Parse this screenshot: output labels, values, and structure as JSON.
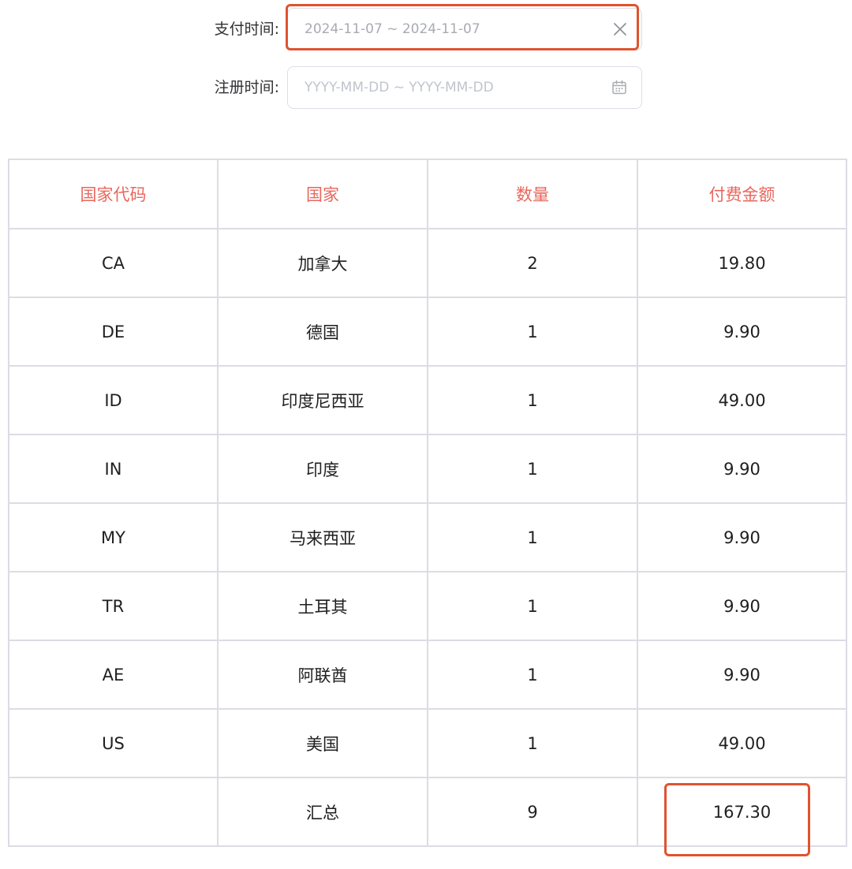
{
  "filters": {
    "pay_time": {
      "label": "支付时间:",
      "value": "2024-11-07 ~ 2024-11-07",
      "clear_icon": "close-icon"
    },
    "register_time": {
      "label": "注册时间:",
      "placeholder": "YYYY-MM-DD ~ YYYY-MM-DD",
      "icon": "calendar-icon"
    }
  },
  "table": {
    "headers": [
      "国家代码",
      "国家",
      "数量",
      "付费金额"
    ],
    "rows": [
      {
        "code": "CA",
        "country": "加拿大",
        "count": "2",
        "amount": "19.80"
      },
      {
        "code": "DE",
        "country": "德国",
        "count": "1",
        "amount": "9.90"
      },
      {
        "code": "ID",
        "country": "印度尼西亚",
        "count": "1",
        "amount": "49.00"
      },
      {
        "code": "IN",
        "country": "印度",
        "count": "1",
        "amount": "9.90"
      },
      {
        "code": "MY",
        "country": "马来西亚",
        "count": "1",
        "amount": "9.90"
      },
      {
        "code": "TR",
        "country": "土耳其",
        "count": "1",
        "amount": "9.90"
      },
      {
        "code": "AE",
        "country": "阿联酋",
        "count": "1",
        "amount": "9.90"
      },
      {
        "code": "US",
        "country": "美国",
        "count": "1",
        "amount": "49.00"
      }
    ],
    "summary": {
      "code": "",
      "country": "汇总",
      "count": "9",
      "amount": "167.30"
    }
  },
  "colors": {
    "header_text": "#e8675d",
    "highlight_border": "#e0532f",
    "table_border": "#dcdce6"
  }
}
